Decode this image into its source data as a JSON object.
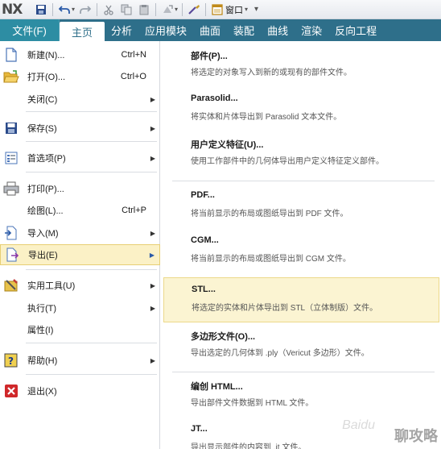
{
  "app": {
    "logo": "NX"
  },
  "qat": {
    "window_label": "窗口"
  },
  "tabs": {
    "file": "文件(F)",
    "items": [
      "主页",
      "分析",
      "应用模块",
      "曲面",
      "装配",
      "曲线",
      "渲染",
      "反向工程"
    ]
  },
  "left_menu": {
    "new": {
      "label": "新建(N)...",
      "shortcut": "Ctrl+N"
    },
    "open": {
      "label": "打开(O)...",
      "shortcut": "Ctrl+O"
    },
    "close": {
      "label": "关闭(C)"
    },
    "save": {
      "label": "保存(S)"
    },
    "preferences": {
      "label": "首选项(P)"
    },
    "print": {
      "label": "打印(P)..."
    },
    "plot": {
      "label": "绘图(L)...",
      "shortcut": "Ctrl+P"
    },
    "import": {
      "label": "导入(M)"
    },
    "export": {
      "label": "导出(E)"
    },
    "utilities": {
      "label": "实用工具(U)"
    },
    "execute": {
      "label": "执行(T)"
    },
    "properties": {
      "label": "属性(I)"
    },
    "help": {
      "label": "帮助(H)"
    },
    "exit": {
      "label": "退出(X)"
    }
  },
  "export_menu": [
    {
      "title": "部件(P)...",
      "desc": "将选定的对象写入到新的或现有的部件文件。"
    },
    {
      "title": "Parasolid...",
      "desc": "将实体和片体导出到 Parasolid 文本文件。"
    },
    {
      "title": "用户定义特征(U)...",
      "desc": "使用工作部件中的几何体导出用户定义特征定义部件。"
    },
    {
      "title": "PDF...",
      "desc": "将当前显示的布局或图纸导出到 PDF 文件。"
    },
    {
      "title": "CGM...",
      "desc": "将当前显示的布局或图纸导出到 CGM 文件。"
    },
    {
      "title": "STL...",
      "desc": "将选定的实体和片体导出到 STL（立体制版）文件。"
    },
    {
      "title": "多边形文件(O)...",
      "desc": "导出选定的几何体到 .ply（Vericut 多边形）文件。"
    },
    {
      "title": "编创 HTML...",
      "desc": "导出部件文件数据到 HTML 文件。"
    },
    {
      "title": "JT...",
      "desc": "导出显示部件的内容到 .jt 文件。"
    }
  ],
  "watermark": {
    "text": "聊攻略",
    "brand": "Baidu"
  },
  "colors": {
    "tab_bar": "#2e6f8a",
    "file_tab": "#2d8da3",
    "highlight": "#fbf1c6"
  }
}
